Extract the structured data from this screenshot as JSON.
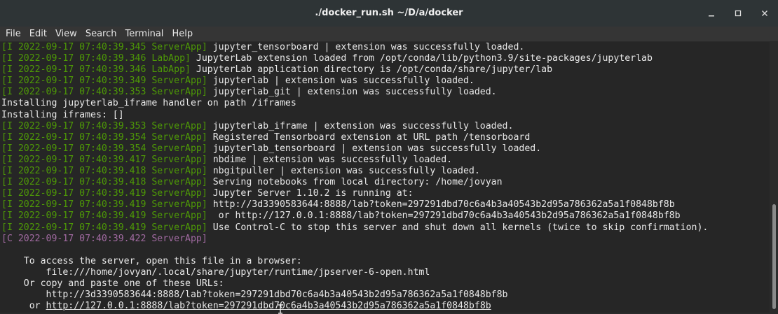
{
  "window": {
    "title": "./docker_run.sh ~/D/a/docker",
    "controls": [
      "minimize",
      "maximize",
      "close"
    ]
  },
  "menu": {
    "items": [
      "File",
      "Edit",
      "View",
      "Search",
      "Terminal",
      "Help"
    ]
  },
  "terminal": {
    "log_lines": [
      {
        "prefix": "[I 2022-09-17 07:40:39.345 ServerApp]",
        "kind": "i",
        "message": " jupyter_tensorboard | extension was successfully loaded."
      },
      {
        "prefix": "[I 2022-09-17 07:40:39.346 LabApp]",
        "kind": "i",
        "message": " JupyterLab extension loaded from /opt/conda/lib/python3.9/site-packages/jupyterlab"
      },
      {
        "prefix": "[I 2022-09-17 07:40:39.346 LabApp]",
        "kind": "i",
        "message": " JupyterLab application directory is /opt/conda/share/jupyter/lab"
      },
      {
        "prefix": "[I 2022-09-17 07:40:39.349 ServerApp]",
        "kind": "i",
        "message": " jupyterlab | extension was successfully loaded."
      },
      {
        "prefix": "[I 2022-09-17 07:40:39.353 ServerApp]",
        "kind": "i",
        "message": " jupyterlab_git | extension was successfully loaded."
      },
      {
        "prefix": "",
        "kind": "plain",
        "message": "Installing jupyterlab_iframe handler on path /iframes"
      },
      {
        "prefix": "",
        "kind": "plain",
        "message": "Installing iframes: []"
      },
      {
        "prefix": "[I 2022-09-17 07:40:39.353 ServerApp]",
        "kind": "i",
        "message": " jupyterlab_iframe | extension was successfully loaded."
      },
      {
        "prefix": "[I 2022-09-17 07:40:39.354 ServerApp]",
        "kind": "i",
        "message": " Registered Tensorboard extension at URL path /tensorboard"
      },
      {
        "prefix": "[I 2022-09-17 07:40:39.354 ServerApp]",
        "kind": "i",
        "message": " jupyterlab_tensorboard | extension was successfully loaded."
      },
      {
        "prefix": "[I 2022-09-17 07:40:39.417 ServerApp]",
        "kind": "i",
        "message": " nbdime | extension was successfully loaded."
      },
      {
        "prefix": "[I 2022-09-17 07:40:39.418 ServerApp]",
        "kind": "i",
        "message": " nbgitpuller | extension was successfully loaded."
      },
      {
        "prefix": "[I 2022-09-17 07:40:39.418 ServerApp]",
        "kind": "i",
        "message": " Serving notebooks from local directory: /home/jovyan"
      },
      {
        "prefix": "[I 2022-09-17 07:40:39.419 ServerApp]",
        "kind": "i",
        "message": " Jupyter Server 1.10.2 is running at:"
      },
      {
        "prefix": "[I 2022-09-17 07:40:39.419 ServerApp]",
        "kind": "i",
        "message": " http://3d3390583644:8888/lab?token=297291dbd70c6a4b3a40543b2d95a786362a5a1f0848bf8b"
      },
      {
        "prefix": "[I 2022-09-17 07:40:39.419 ServerApp]",
        "kind": "i",
        "message": "  or http://127.0.0.1:8888/lab?token=297291dbd70c6a4b3a40543b2d95a786362a5a1f0848bf8b"
      },
      {
        "prefix": "[I 2022-09-17 07:40:39.419 ServerApp]",
        "kind": "i",
        "message": " Use Control-C to stop this server and shut down all kernels (twice to skip confirmation)."
      },
      {
        "prefix": "[C 2022-09-17 07:40:39.422 ServerApp]",
        "kind": "c",
        "message": ""
      },
      {
        "prefix": "",
        "kind": "plain",
        "message": ""
      },
      {
        "prefix": "",
        "kind": "plain",
        "message": "    To access the server, open this file in a browser:"
      },
      {
        "prefix": "",
        "kind": "plain",
        "message": "        file:///home/jovyan/.local/share/jupyter/runtime/jpserver-6-open.html"
      },
      {
        "prefix": "",
        "kind": "plain",
        "message": "    Or copy and paste one of these URLs:"
      },
      {
        "prefix": "",
        "kind": "plain",
        "message": "        http://3d3390583644:8888/lab?token=297291dbd70c6a4b3a40543b2d95a786362a5a1f0848bf8b"
      }
    ],
    "last_line": {
      "lead": "     or ",
      "link": "http://127.0.0.1:8888/lab?token=297291dbd70c6a4b3a40543b2d95a786362a5a1f0848bf8b"
    }
  },
  "colors": {
    "info_prefix": "#4e9a06",
    "critical_prefix": "#a06aa0",
    "text": "#e8e8e8",
    "background": "#262626"
  }
}
